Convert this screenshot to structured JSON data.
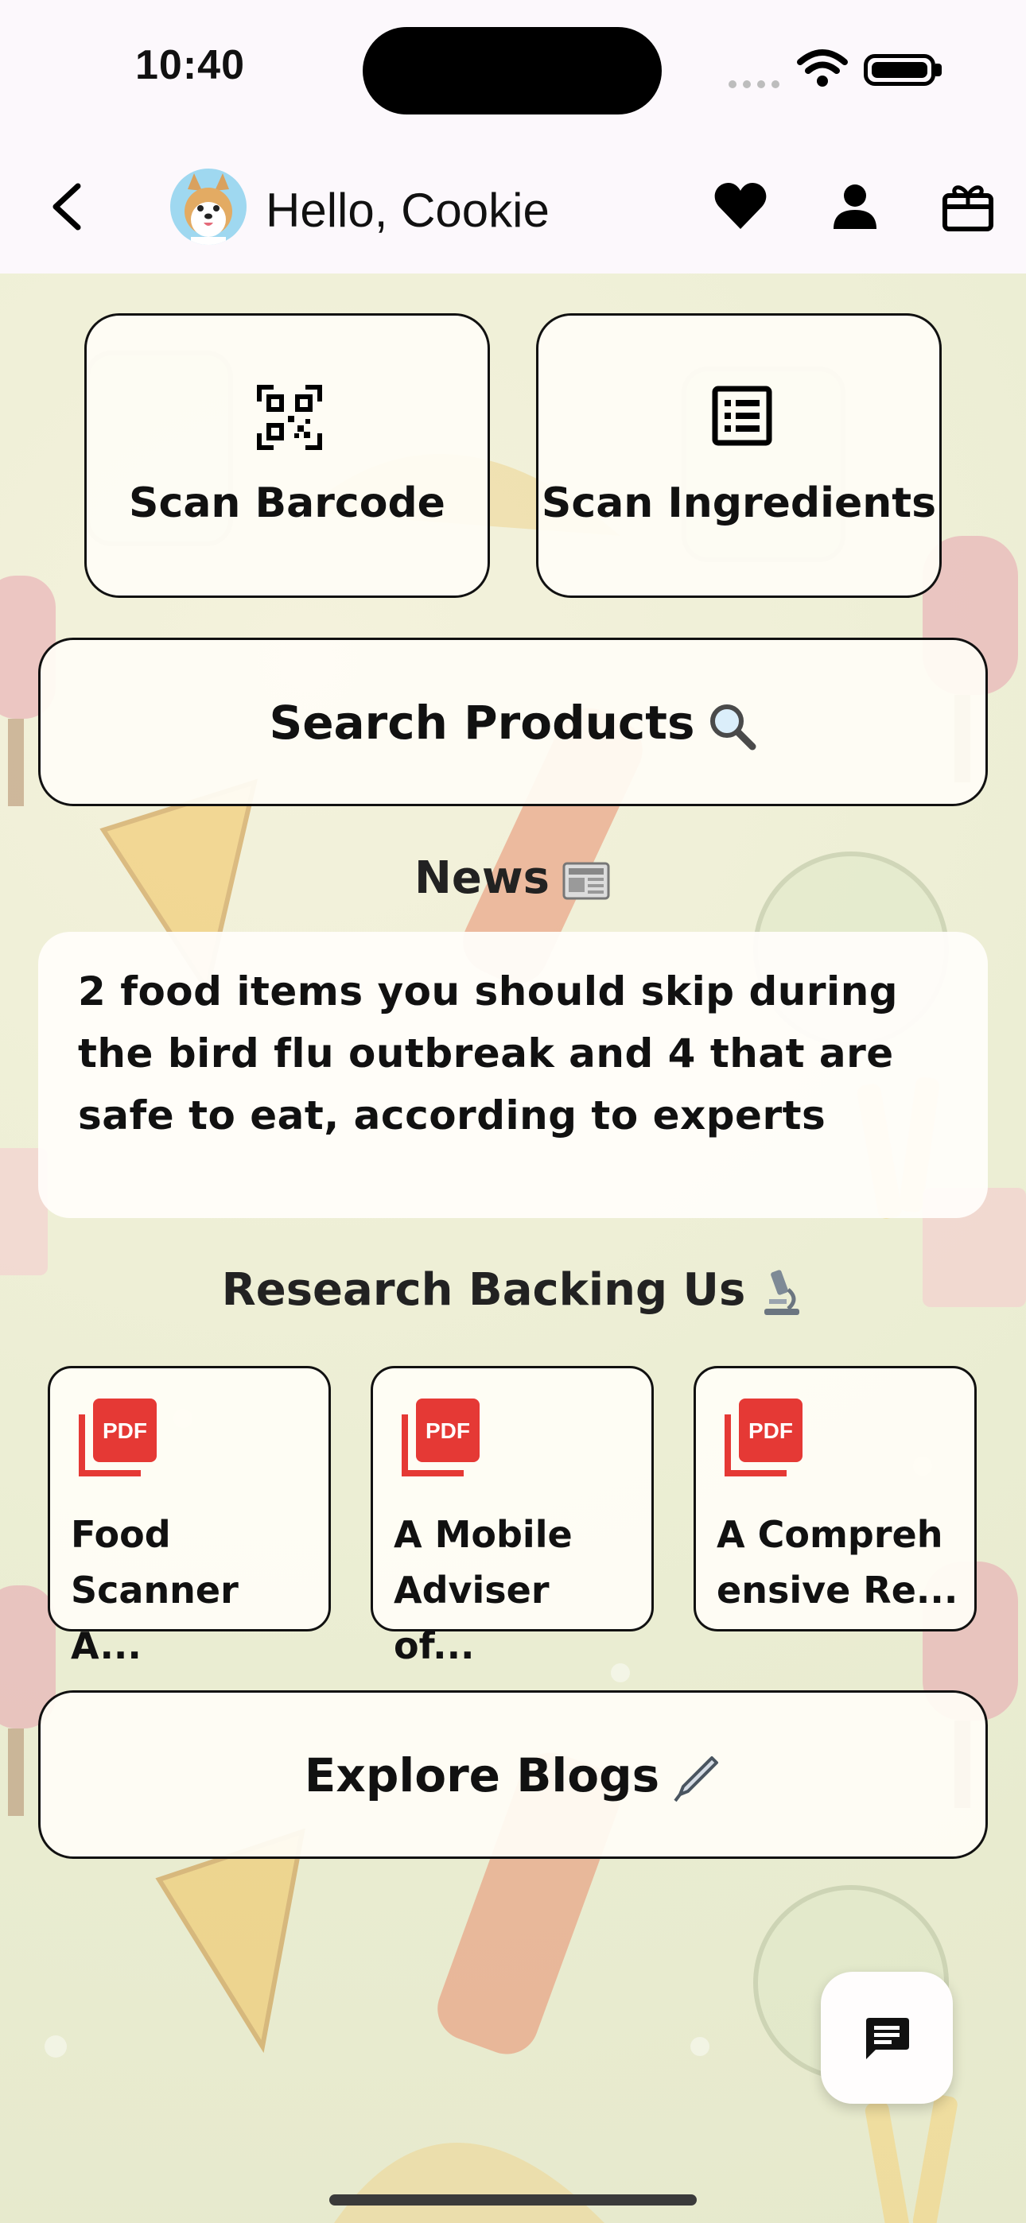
{
  "status_bar": {
    "time": "10:40"
  },
  "header": {
    "greeting": "Hello, Cookie",
    "icons": [
      "back-icon",
      "heart-icon",
      "person-icon",
      "gift-icon"
    ]
  },
  "scan": {
    "barcode_label": "Scan Barcode",
    "ingredients_label": "Scan Ingredients"
  },
  "search": {
    "label": "Search Products"
  },
  "news": {
    "title": "News",
    "headline": "2 food items you should skip during the bird flu outbreak and 4 that are safe to eat, according to experts"
  },
  "research": {
    "title": "Research Backing Us",
    "papers": [
      {
        "title": "Food\nScanner A..."
      },
      {
        "title": "A Mobile\nAdviser of..."
      },
      {
        "title": "A Compreh\nensive Re..."
      }
    ]
  },
  "blogs": {
    "label": "Explore Blogs"
  },
  "colors": {
    "accent_red": "#e53935",
    "card_bg": "#fffdf6",
    "border": "#111111"
  }
}
